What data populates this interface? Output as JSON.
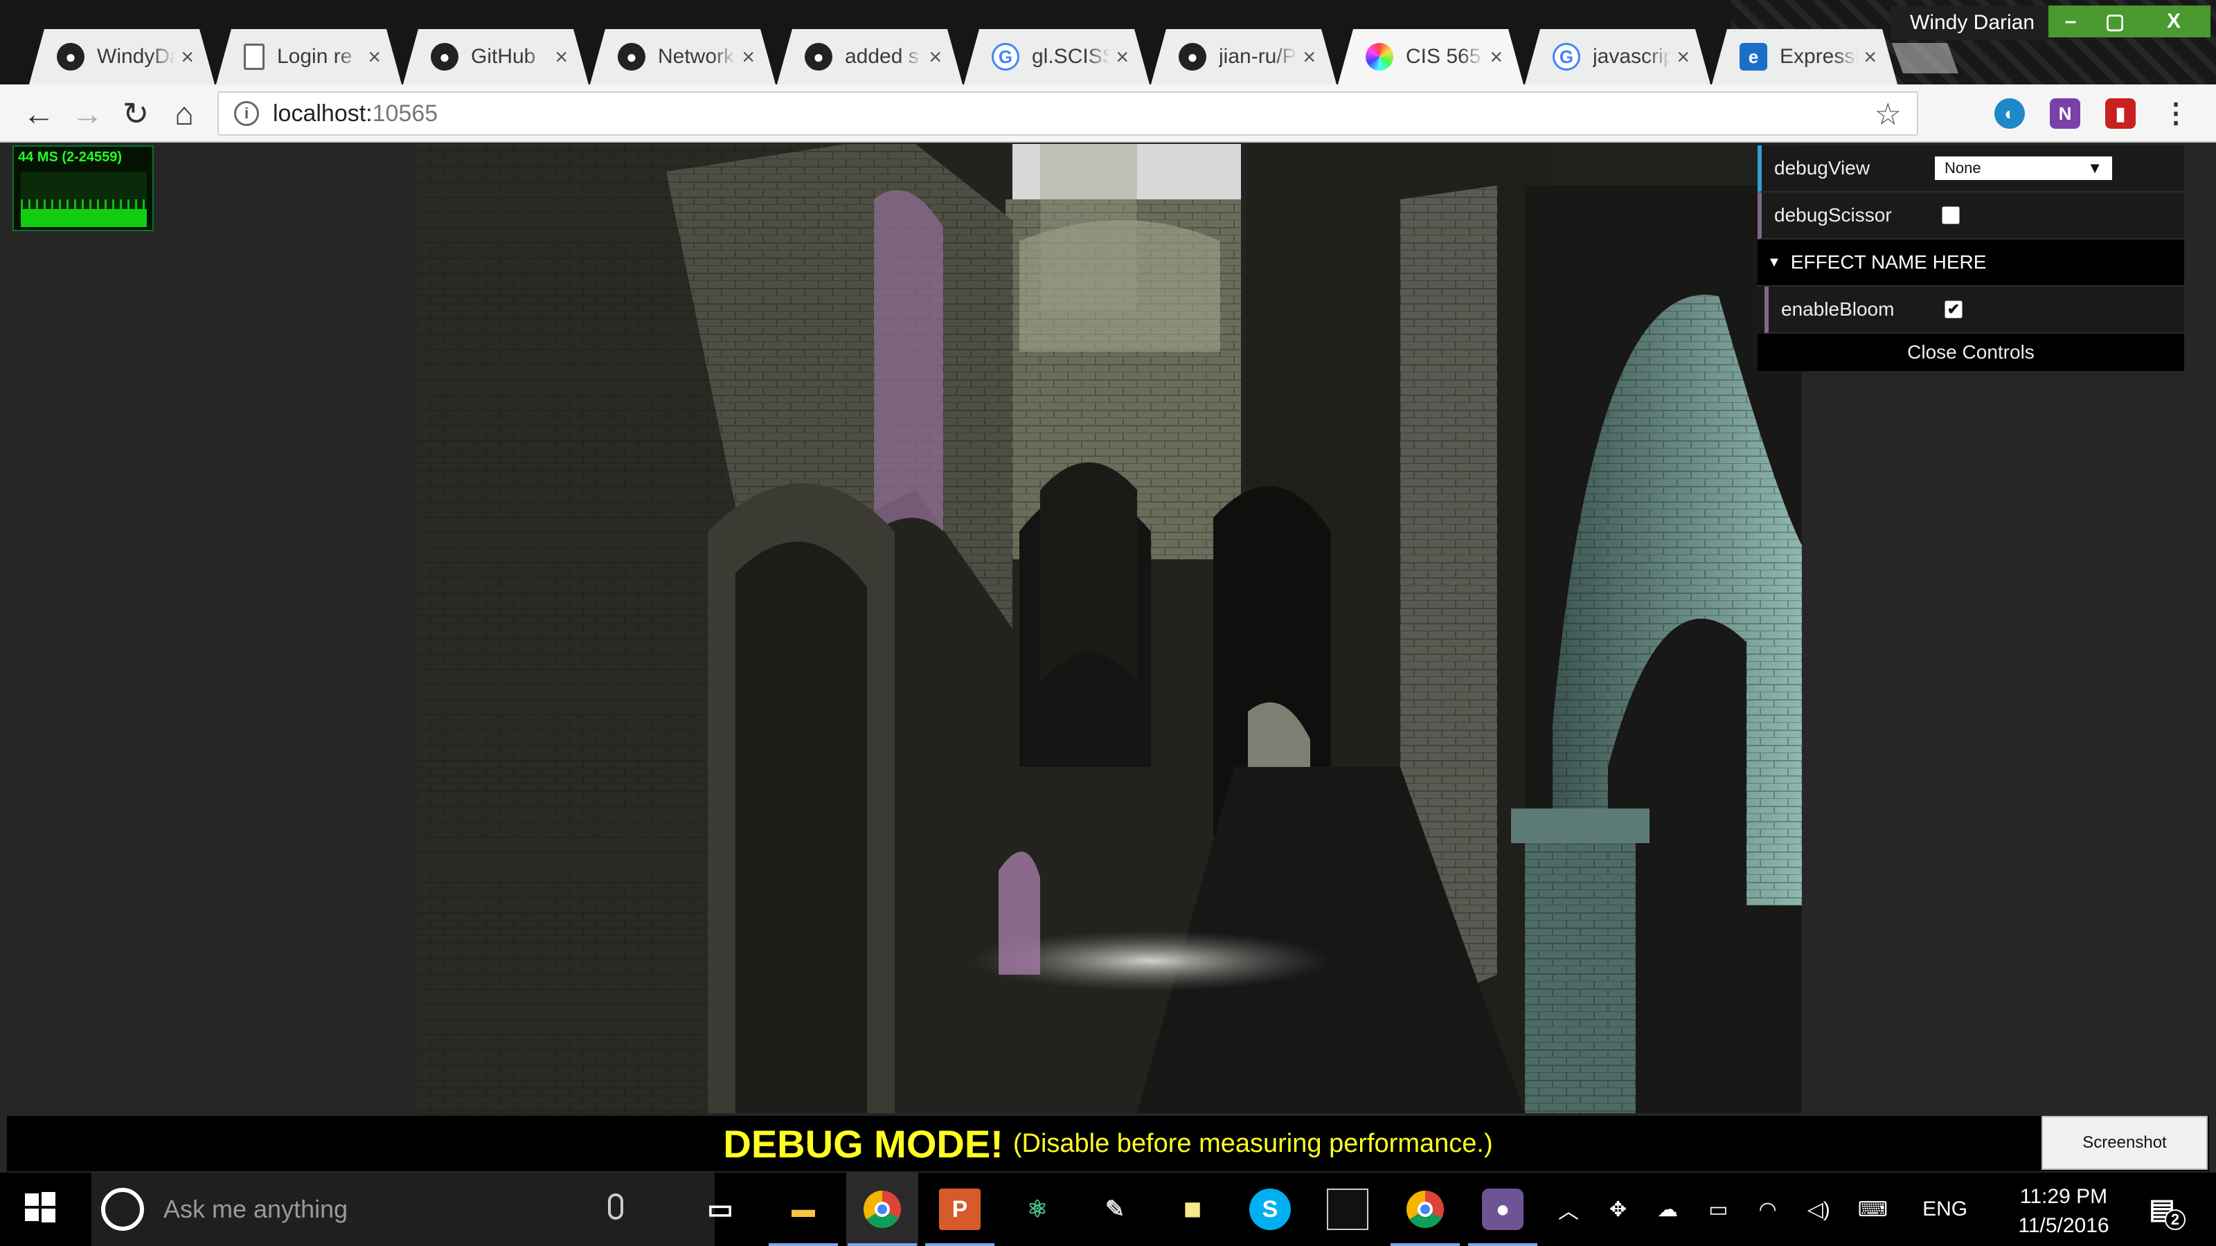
{
  "browser": {
    "profile_name": "Windy Darian",
    "window_controls": {
      "minimize": "–",
      "maximize": "▢",
      "close": "X"
    },
    "tabs": [
      {
        "title": "WindyDa",
        "icon": "github-icon"
      },
      {
        "title": "Login re",
        "icon": "page-icon"
      },
      {
        "title": "GitHub",
        "icon": "github-icon"
      },
      {
        "title": "Network",
        "icon": "github-icon"
      },
      {
        "title": "added s",
        "icon": "github-icon"
      },
      {
        "title": "gl.SCISS",
        "icon": "google-icon"
      },
      {
        "title": "jian-ru/P",
        "icon": "github-icon"
      },
      {
        "title": "CIS 565",
        "icon": "color-wheel-icon",
        "active": true
      },
      {
        "title": "javascrip",
        "icon": "google-icon"
      },
      {
        "title": "Expressi",
        "icon": "express-icon"
      }
    ],
    "tab_close_glyph": "×",
    "address": {
      "host": "localhost:",
      "port": "10565"
    }
  },
  "page": {
    "stats": {
      "text": "44 MS (2-24559)"
    },
    "gui": {
      "debug_view_label": "debugView",
      "debug_view_value": "None",
      "debug_scissor_label": "debugScissor",
      "debug_scissor_checked": false,
      "folder_title": "EFFECT NAME HERE",
      "enable_bloom_label": "enableBloom",
      "enable_bloom_checked": true,
      "close_label": "Close Controls"
    },
    "debug_banner": {
      "title": "DEBUG MODE!",
      "subtitle": "(Disable before measuring performance.)"
    },
    "screenshot_button": "Screenshot"
  },
  "taskbar": {
    "search_placeholder": "Ask me anything",
    "language": "ENG",
    "time": "11:29 PM",
    "date": "11/5/2016",
    "notification_count": "2",
    "pinned": [
      "windows-icon",
      "task-view-icon",
      "file-explorer-icon",
      "chrome-icon",
      "office-icon",
      "atom-icon",
      "paint-icon",
      "sticky-notes-icon",
      "skype-icon",
      "terminal-icon",
      "chrome-icon",
      "github-desktop-icon"
    ]
  },
  "colors": {
    "accent_gui_select": "#2fa1d6",
    "accent_gui_check": "#806787",
    "debug_text": "#ffff22",
    "stats_green": "#22ff22"
  }
}
